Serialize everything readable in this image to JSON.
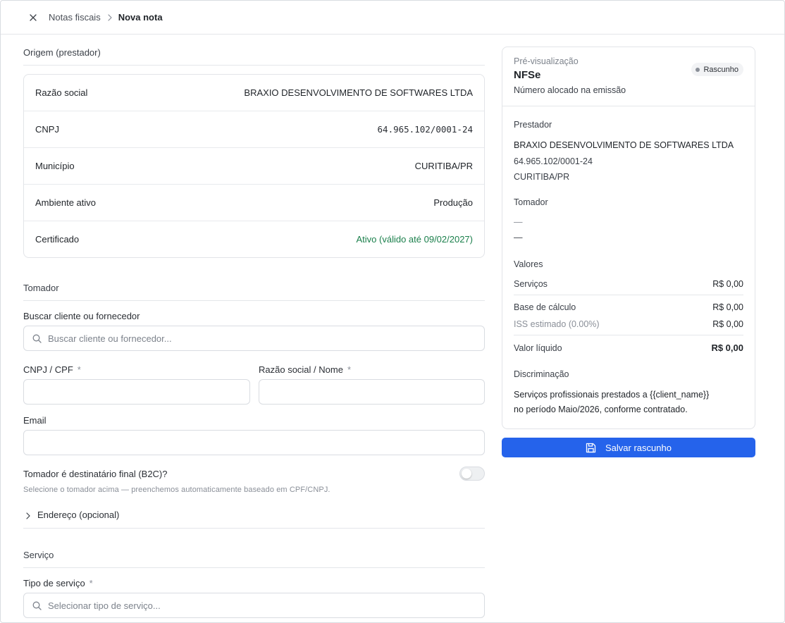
{
  "breadcrumb": {
    "parent": "Notas fiscais",
    "current": "Nova nota"
  },
  "origem": {
    "title": "Origem (prestador)",
    "rows": [
      {
        "label": "Razão social",
        "value": "BRAXIO DESENVOLVIMENTO DE SOFTWARES LTDA"
      },
      {
        "label": "CNPJ",
        "value": "64.965.102/0001-24"
      },
      {
        "label": "Município",
        "value": "CURITIBA/PR"
      },
      {
        "label": "Ambiente ativo",
        "value": "Produção"
      },
      {
        "label": "Certificado",
        "value": "Ativo (válido até 09/02/2027)"
      }
    ]
  },
  "tomador": {
    "title": "Tomador",
    "search_label": "Buscar cliente ou fornecedor",
    "search_placeholder": "Buscar cliente ou fornecedor...",
    "cnpj_label": "CNPJ / CPF",
    "razao_label": "Razão social / Nome",
    "required_mark": "*",
    "email_label": "Email",
    "b2c_label": "Tomador é destinatário final (B2C)?",
    "b2c_on": false,
    "hint": "Selecione o tomador acima — preenchemos automaticamente baseado em CPF/CNPJ.",
    "endereco_label": "Endereço (opcional)"
  },
  "servico": {
    "title": "Serviço",
    "tipo_label": "Tipo de serviço",
    "tipo_placeholder": "Selecionar tipo de serviço..."
  },
  "preview": {
    "kicker": "Pré-visualização",
    "title": "NFSe",
    "subtitle": "Número alocado na emissão",
    "badge": "Rascunho",
    "prestador_title": "Prestador",
    "prestador_name": "BRAXIO DESENVOLVIMENTO DE SOFTWARES LTDA",
    "prestador_cnpj": "64.965.102/0001-24",
    "prestador_city": "CURITIBA/PR",
    "tomador_title": "Tomador",
    "tomador_line1": "—",
    "tomador_line2": "—",
    "valores_title": "Valores",
    "servicos_label": "Serviços",
    "servicos_value": "R$ 0,00",
    "base_label": "Base de cálculo",
    "base_value": "R$ 0,00",
    "iss_label": "ISS estimado (0.00%)",
    "iss_value": "R$ 0,00",
    "liquido_label": "Valor líquido",
    "liquido_value": "R$ 0,00",
    "discriminacao_title": "Discriminação",
    "discriminacao_line1": "Serviços profissionais prestados a {{client_name}}",
    "discriminacao_line2": "no período Maio/2026, conforme contratado."
  },
  "save_button": {
    "label": "Salvar rascunho"
  },
  "colors": {
    "accent": "#2563eb",
    "success": "#1a7f4b"
  }
}
